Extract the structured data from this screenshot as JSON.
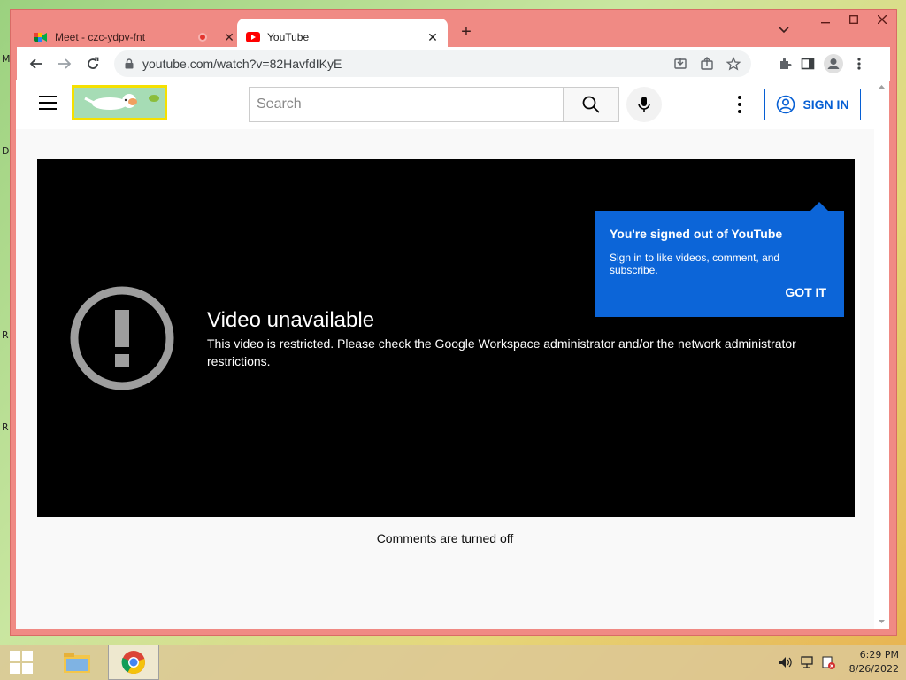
{
  "desktop": {
    "labels": [
      "M",
      "D",
      "R",
      "R"
    ]
  },
  "browser": {
    "tabs": [
      {
        "title": "Meet - czc-ydpv-fnt",
        "active": false,
        "recording": true
      },
      {
        "title": "YouTube",
        "active": true
      }
    ],
    "url": "youtube.com/watch?v=82HavfdIKyE"
  },
  "youtube": {
    "search_placeholder": "Search",
    "sign_in_label": "SIGN IN",
    "tooltip": {
      "title": "You're signed out of YouTube",
      "message": "Sign in to like videos, comment, and subscribe.",
      "button": "GOT IT"
    },
    "player": {
      "error_title": "Video unavailable",
      "error_message": "This video is restricted. Please check the Google Workspace administrator and/or the network administrator restrictions."
    },
    "comments_status": "Comments are turned off"
  },
  "taskbar": {
    "time": "6:29 PM",
    "date": "8/26/2022"
  },
  "colors": {
    "chrome_frame": "#f08a84",
    "yt_blue": "#065fd4",
    "tooltip_blue": "#0c65d8",
    "youtube_red": "#ff0000"
  }
}
